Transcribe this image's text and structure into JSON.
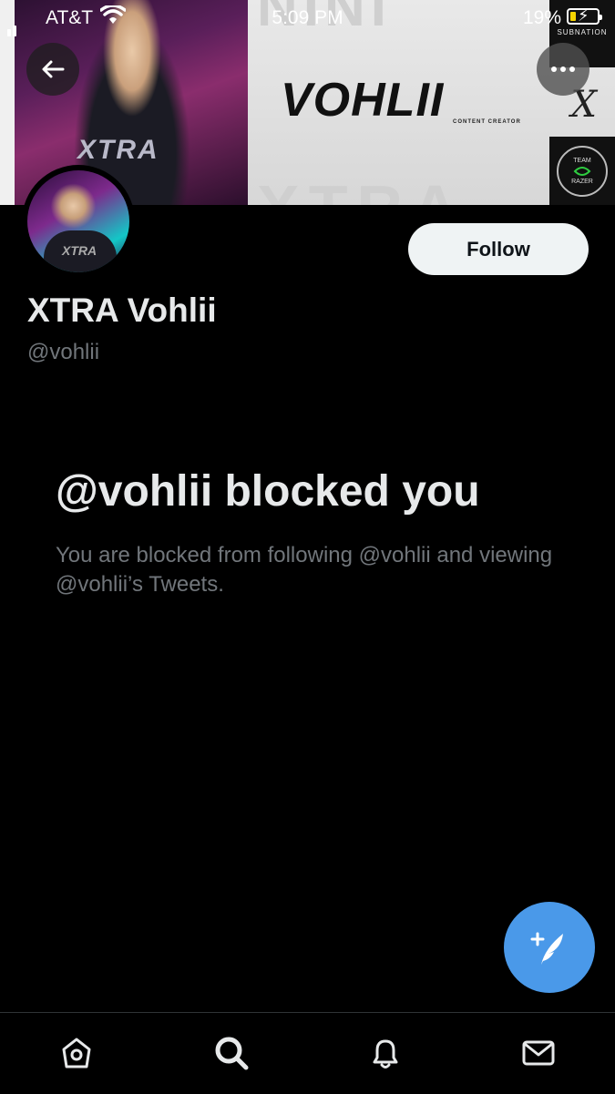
{
  "status_bar": {
    "carrier": "AT&T",
    "time": "5:09 PM",
    "battery_percent": "19%"
  },
  "banner": {
    "brand_name": "VOHLII",
    "brand_subtitle": "CONTENT CREATOR",
    "shirt_text": "XTRA",
    "subnation_label": "SUBNATION",
    "razer_label_top": "TEAM",
    "razer_label_bottom": "RAZER"
  },
  "profile": {
    "follow_label": "Follow",
    "display_name": "XTRA Vohlii",
    "handle": "@vohlii"
  },
  "blocked": {
    "title": "@vohlii blocked you",
    "body": "You are blocked from following @vohlii and viewing @vohlii’s Tweets."
  },
  "colors": {
    "background": "#000000",
    "fab": "#4a99e9",
    "follow_bg": "#eff3f4",
    "muted_text": "#71767b"
  },
  "icons": {
    "back": "back-arrow-icon",
    "more": "more-dots-icon",
    "compose": "compose-tweet-icon",
    "tabs": [
      "home-icon",
      "search-icon",
      "notifications-icon",
      "messages-icon"
    ]
  }
}
